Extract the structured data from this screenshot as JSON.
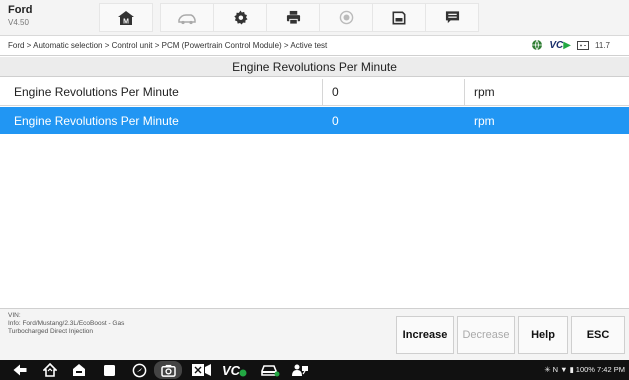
{
  "app": {
    "name": "Ford",
    "version": "V4.50"
  },
  "toolbar": {
    "icons": [
      "home-icon",
      "vehicle-swap-icon",
      "gear-icon",
      "printer-icon",
      "record-icon",
      "save-icon",
      "message-icon"
    ]
  },
  "breadcrumb": "Ford > Automatic selection > Control unit > PCM (Powertrain Control Module) > Active test",
  "status": {
    "vci_label": "VC",
    "battery_text": "11.7"
  },
  "section_title": "Engine Revolutions Per Minute",
  "table": {
    "rows": [
      {
        "name": "Engine Revolutions Per Minute",
        "value": "0",
        "unit": "rpm",
        "selected": false
      },
      {
        "name": "Engine Revolutions Per Minute",
        "value": "0",
        "unit": "rpm",
        "selected": true
      }
    ]
  },
  "vehicle_info": {
    "vin_label": "VIN:",
    "info_line1": "Info: Ford/Mustang/2.3L/EcoBoost - Gas",
    "info_line2": "Turbocharged Direct Injection"
  },
  "actions": {
    "increase": "Increase",
    "decrease": "Decrease",
    "help": "Help",
    "esc": "ESC"
  },
  "system_status": "✳ N ▼ ▮ 100% 7:42 PM",
  "colors": {
    "selected_row": "#2196f3",
    "vci_accent": "#23a843"
  }
}
